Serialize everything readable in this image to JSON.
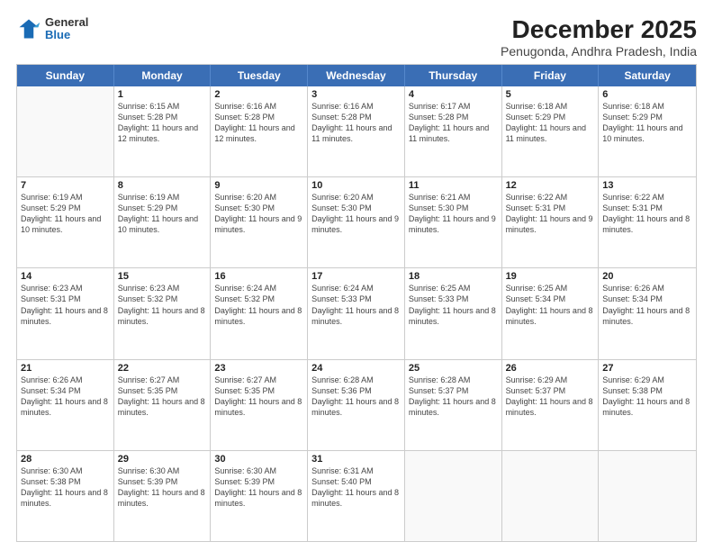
{
  "header": {
    "logo_general": "General",
    "logo_blue": "Blue",
    "month_title": "December 2025",
    "location": "Penugonda, Andhra Pradesh, India"
  },
  "days_of_week": [
    "Sunday",
    "Monday",
    "Tuesday",
    "Wednesday",
    "Thursday",
    "Friday",
    "Saturday"
  ],
  "rows": [
    [
      {
        "day": "",
        "sunrise": "",
        "sunset": "",
        "daylight": ""
      },
      {
        "day": "1",
        "sunrise": "Sunrise: 6:15 AM",
        "sunset": "Sunset: 5:28 PM",
        "daylight": "Daylight: 11 hours and 12 minutes."
      },
      {
        "day": "2",
        "sunrise": "Sunrise: 6:16 AM",
        "sunset": "Sunset: 5:28 PM",
        "daylight": "Daylight: 11 hours and 12 minutes."
      },
      {
        "day": "3",
        "sunrise": "Sunrise: 6:16 AM",
        "sunset": "Sunset: 5:28 PM",
        "daylight": "Daylight: 11 hours and 11 minutes."
      },
      {
        "day": "4",
        "sunrise": "Sunrise: 6:17 AM",
        "sunset": "Sunset: 5:28 PM",
        "daylight": "Daylight: 11 hours and 11 minutes."
      },
      {
        "day": "5",
        "sunrise": "Sunrise: 6:18 AM",
        "sunset": "Sunset: 5:29 PM",
        "daylight": "Daylight: 11 hours and 11 minutes."
      },
      {
        "day": "6",
        "sunrise": "Sunrise: 6:18 AM",
        "sunset": "Sunset: 5:29 PM",
        "daylight": "Daylight: 11 hours and 10 minutes."
      }
    ],
    [
      {
        "day": "7",
        "sunrise": "Sunrise: 6:19 AM",
        "sunset": "Sunset: 5:29 PM",
        "daylight": "Daylight: 11 hours and 10 minutes."
      },
      {
        "day": "8",
        "sunrise": "Sunrise: 6:19 AM",
        "sunset": "Sunset: 5:29 PM",
        "daylight": "Daylight: 11 hours and 10 minutes."
      },
      {
        "day": "9",
        "sunrise": "Sunrise: 6:20 AM",
        "sunset": "Sunset: 5:30 PM",
        "daylight": "Daylight: 11 hours and 9 minutes."
      },
      {
        "day": "10",
        "sunrise": "Sunrise: 6:20 AM",
        "sunset": "Sunset: 5:30 PM",
        "daylight": "Daylight: 11 hours and 9 minutes."
      },
      {
        "day": "11",
        "sunrise": "Sunrise: 6:21 AM",
        "sunset": "Sunset: 5:30 PM",
        "daylight": "Daylight: 11 hours and 9 minutes."
      },
      {
        "day": "12",
        "sunrise": "Sunrise: 6:22 AM",
        "sunset": "Sunset: 5:31 PM",
        "daylight": "Daylight: 11 hours and 9 minutes."
      },
      {
        "day": "13",
        "sunrise": "Sunrise: 6:22 AM",
        "sunset": "Sunset: 5:31 PM",
        "daylight": "Daylight: 11 hours and 8 minutes."
      }
    ],
    [
      {
        "day": "14",
        "sunrise": "Sunrise: 6:23 AM",
        "sunset": "Sunset: 5:31 PM",
        "daylight": "Daylight: 11 hours and 8 minutes."
      },
      {
        "day": "15",
        "sunrise": "Sunrise: 6:23 AM",
        "sunset": "Sunset: 5:32 PM",
        "daylight": "Daylight: 11 hours and 8 minutes."
      },
      {
        "day": "16",
        "sunrise": "Sunrise: 6:24 AM",
        "sunset": "Sunset: 5:32 PM",
        "daylight": "Daylight: 11 hours and 8 minutes."
      },
      {
        "day": "17",
        "sunrise": "Sunrise: 6:24 AM",
        "sunset": "Sunset: 5:33 PM",
        "daylight": "Daylight: 11 hours and 8 minutes."
      },
      {
        "day": "18",
        "sunrise": "Sunrise: 6:25 AM",
        "sunset": "Sunset: 5:33 PM",
        "daylight": "Daylight: 11 hours and 8 minutes."
      },
      {
        "day": "19",
        "sunrise": "Sunrise: 6:25 AM",
        "sunset": "Sunset: 5:34 PM",
        "daylight": "Daylight: 11 hours and 8 minutes."
      },
      {
        "day": "20",
        "sunrise": "Sunrise: 6:26 AM",
        "sunset": "Sunset: 5:34 PM",
        "daylight": "Daylight: 11 hours and 8 minutes."
      }
    ],
    [
      {
        "day": "21",
        "sunrise": "Sunrise: 6:26 AM",
        "sunset": "Sunset: 5:34 PM",
        "daylight": "Daylight: 11 hours and 8 minutes."
      },
      {
        "day": "22",
        "sunrise": "Sunrise: 6:27 AM",
        "sunset": "Sunset: 5:35 PM",
        "daylight": "Daylight: 11 hours and 8 minutes."
      },
      {
        "day": "23",
        "sunrise": "Sunrise: 6:27 AM",
        "sunset": "Sunset: 5:35 PM",
        "daylight": "Daylight: 11 hours and 8 minutes."
      },
      {
        "day": "24",
        "sunrise": "Sunrise: 6:28 AM",
        "sunset": "Sunset: 5:36 PM",
        "daylight": "Daylight: 11 hours and 8 minutes."
      },
      {
        "day": "25",
        "sunrise": "Sunrise: 6:28 AM",
        "sunset": "Sunset: 5:37 PM",
        "daylight": "Daylight: 11 hours and 8 minutes."
      },
      {
        "day": "26",
        "sunrise": "Sunrise: 6:29 AM",
        "sunset": "Sunset: 5:37 PM",
        "daylight": "Daylight: 11 hours and 8 minutes."
      },
      {
        "day": "27",
        "sunrise": "Sunrise: 6:29 AM",
        "sunset": "Sunset: 5:38 PM",
        "daylight": "Daylight: 11 hours and 8 minutes."
      }
    ],
    [
      {
        "day": "28",
        "sunrise": "Sunrise: 6:30 AM",
        "sunset": "Sunset: 5:38 PM",
        "daylight": "Daylight: 11 hours and 8 minutes."
      },
      {
        "day": "29",
        "sunrise": "Sunrise: 6:30 AM",
        "sunset": "Sunset: 5:39 PM",
        "daylight": "Daylight: 11 hours and 8 minutes."
      },
      {
        "day": "30",
        "sunrise": "Sunrise: 6:30 AM",
        "sunset": "Sunset: 5:39 PM",
        "daylight": "Daylight: 11 hours and 8 minutes."
      },
      {
        "day": "31",
        "sunrise": "Sunrise: 6:31 AM",
        "sunset": "Sunset: 5:40 PM",
        "daylight": "Daylight: 11 hours and 8 minutes."
      },
      {
        "day": "",
        "sunrise": "",
        "sunset": "",
        "daylight": ""
      },
      {
        "day": "",
        "sunrise": "",
        "sunset": "",
        "daylight": ""
      },
      {
        "day": "",
        "sunrise": "",
        "sunset": "",
        "daylight": ""
      }
    ]
  ]
}
